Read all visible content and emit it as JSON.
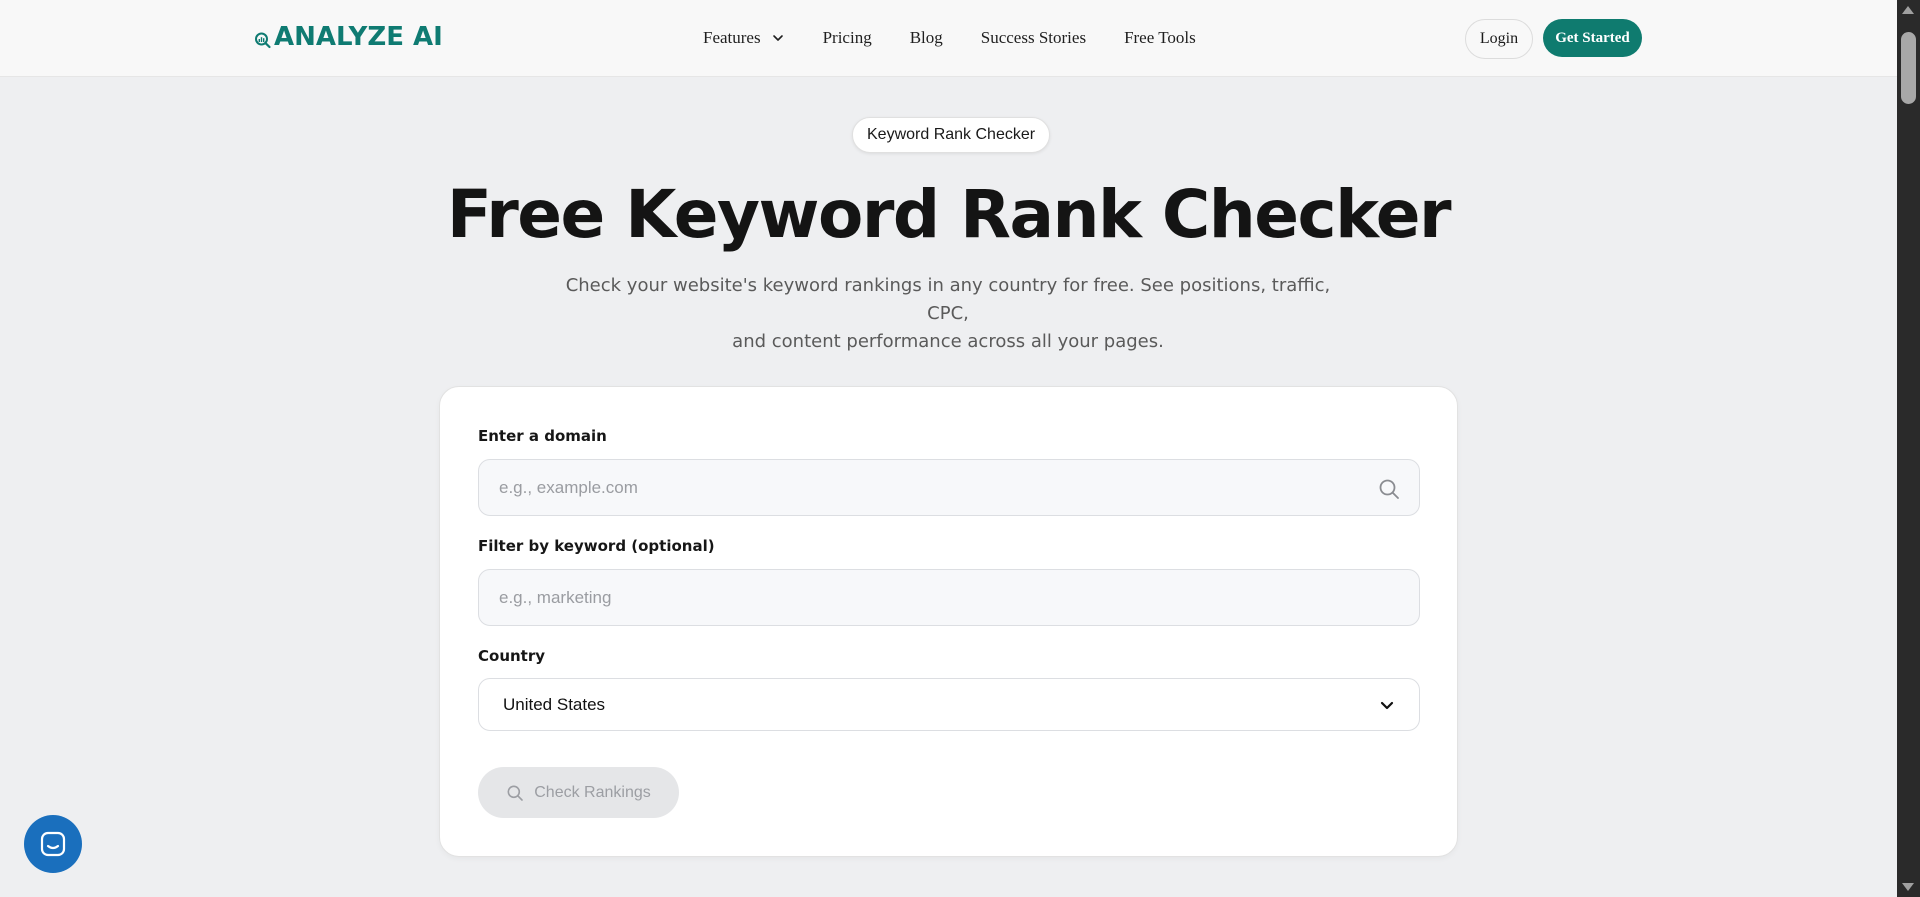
{
  "nav": {
    "brand": "ANALYZE AI",
    "links": [
      {
        "label": "Features"
      },
      {
        "label": "Pricing"
      },
      {
        "label": "Blog"
      },
      {
        "label": "Success Stories"
      },
      {
        "label": "Free Tools"
      }
    ],
    "login_label": "Login",
    "cta_label": "Get Started"
  },
  "hero": {
    "pill": "Keyword Rank Checker",
    "title": "Free Keyword Rank Checker",
    "subtitle_line1": "Check your website's keyword rankings in any country for free. See positions, traffic, CPC,",
    "subtitle_line2": "and content performance across all your pages."
  },
  "form": {
    "domain_label": "Enter a domain",
    "domain_placeholder": "e.g., example.com",
    "keyword_label": "Filter by keyword (optional)",
    "keyword_placeholder": "e.g., marketing",
    "country_label": "Country",
    "country_value": "United States",
    "submit_label": "Check Rankings"
  },
  "colors": {
    "brand": "#0f7b6f",
    "chat": "#1a6fbd",
    "page_bg": "#eeeff1"
  }
}
